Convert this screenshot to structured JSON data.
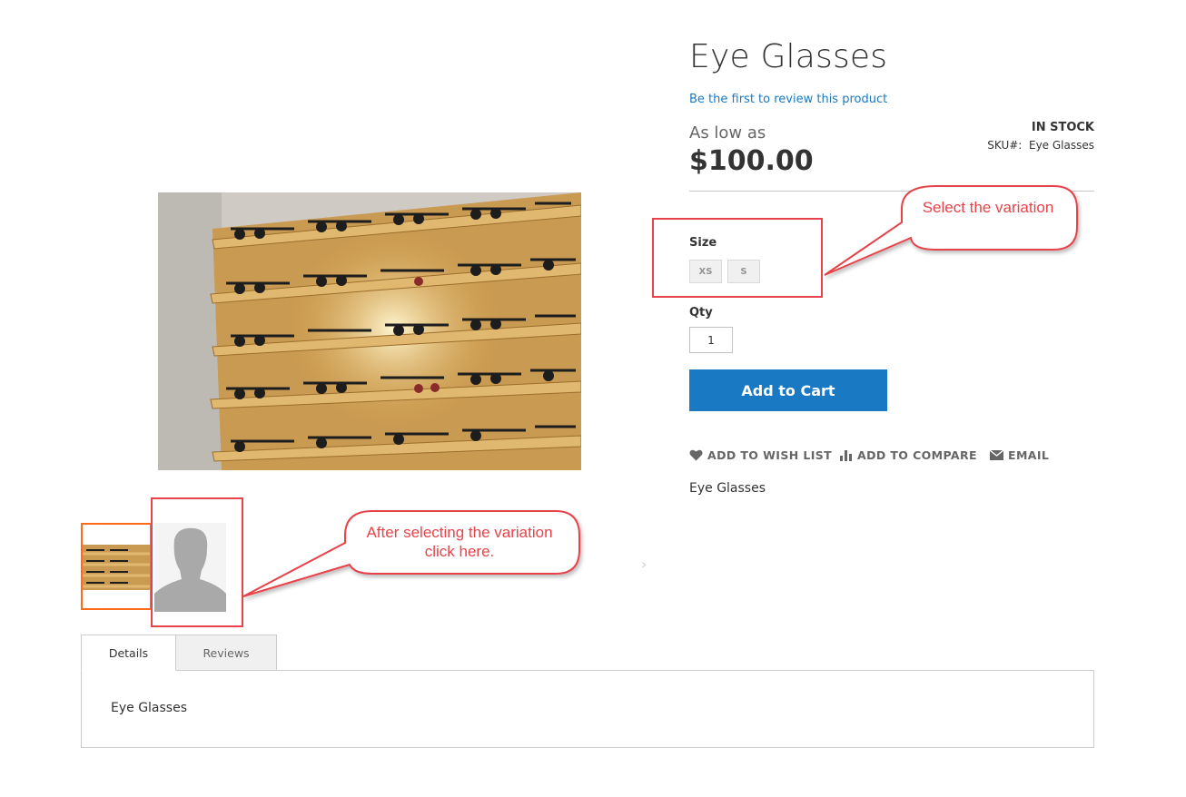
{
  "product": {
    "title": "Eye Glasses",
    "review_link": "Be the first to review this product",
    "price_prefix": "As low as",
    "price": "$100.00",
    "stock": "IN STOCK",
    "sku_label": "SKU#:",
    "sku_value": "Eye Glasses",
    "short_description": "Eye Glasses"
  },
  "options": {
    "size_label": "Size",
    "sizes": [
      "XS",
      "S"
    ],
    "qty_label": "Qty",
    "qty_value": "1"
  },
  "actions": {
    "add_to_cart": "Add to Cart",
    "wish_list": "ADD TO WISH LIST",
    "compare": "ADD TO COMPARE",
    "email": "EMAIL"
  },
  "tabs": {
    "items": [
      "Details",
      "Reviews"
    ],
    "active": "Details",
    "details_content": "Eye Glasses"
  },
  "gallery": {
    "next_icon": "chevron-right-icon"
  },
  "annotations": {
    "select_variation": "Select the variation",
    "after_selecting": "After selecting the variation click here."
  },
  "colors": {
    "accent": "#1979c3",
    "active_thumb": "#ff6b1a",
    "annotation": "#e8434a"
  }
}
